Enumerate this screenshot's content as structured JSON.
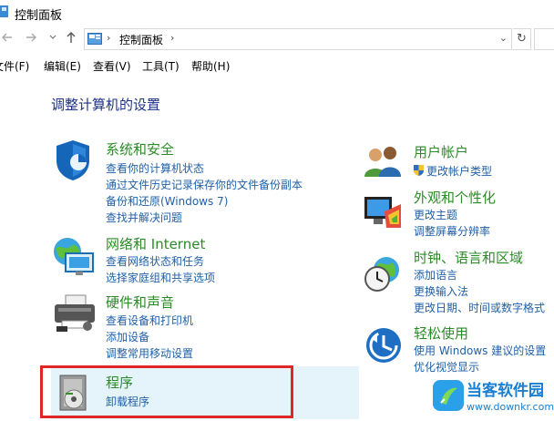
{
  "window": {
    "title": "控制面板"
  },
  "navigation": {
    "back_icon": "back-arrow-icon",
    "forward_icon": "forward-arrow-icon",
    "up_icon": "up-arrow-icon",
    "separator": "›",
    "breadcrumb": "控制面板",
    "dropdown_glyph": "⌄",
    "refresh_glyph": "↻"
  },
  "menu": {
    "items": [
      "文件(F)",
      "编辑(E)",
      "查看(V)",
      "工具(T)",
      "帮助(H)"
    ]
  },
  "main": {
    "heading": "调整计算机的设置",
    "left_categories": [
      {
        "title": "系统和安全",
        "icon": "shield-icon",
        "links": [
          "查看你的计算机状态",
          "通过文件历史记录保存你的文件备份副本",
          "备份和还原(Windows 7)",
          "查找并解决问题"
        ]
      },
      {
        "title": "网络和 Internet",
        "icon": "network-globe-icon",
        "links": [
          "查看网络状态和任务",
          "选择家庭组和共享选项"
        ]
      },
      {
        "title": "硬件和声音",
        "icon": "printer-icon",
        "links": [
          "查看设备和打印机",
          "添加设备",
          "调整常用移动设置"
        ]
      },
      {
        "title": "程序",
        "icon": "programs-disc-icon",
        "links": [
          "卸载程序"
        ]
      }
    ],
    "right_categories": [
      {
        "title": "用户帐户",
        "icon": "users-icon",
        "links": [
          "更改帐户类型"
        ]
      },
      {
        "title": "外观和个性化",
        "icon": "appearance-monitor-icon",
        "links": [
          "更改主题",
          "调整屏幕分辨率"
        ]
      },
      {
        "title": "时钟、语言和区域",
        "icon": "clock-globe-icon",
        "links": [
          "添加语言",
          "更换输入法",
          "更改日期、时间或数字格式"
        ]
      },
      {
        "title": "轻松使用",
        "icon": "ease-of-access-icon",
        "links": [
          "使用 Windows 建议的设置",
          "优化视觉显示"
        ]
      }
    ]
  },
  "watermark": {
    "title": "当客软件园",
    "url": "www.downkr.com"
  },
  "colors": {
    "category_title": "#2a8c26",
    "link": "#2060a8",
    "heading": "#1e3287",
    "highlight_box": "#e1262a",
    "hover_bg": "#e5f3fb"
  }
}
